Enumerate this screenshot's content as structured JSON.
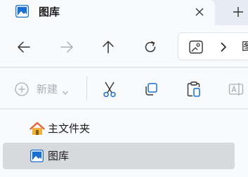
{
  "tab": {
    "title": "图库",
    "icon": "gallery-icon",
    "close_icon": "close-icon",
    "new_tab_icon": "plus-icon"
  },
  "nav": {
    "back_icon": "arrow-left-icon",
    "forward_icon": "arrow-right-icon",
    "up_icon": "arrow-up-icon",
    "refresh_icon": "refresh-icon",
    "address": {
      "icon": "gallery-outline-icon",
      "separator_icon": "chevron-right-icon",
      "path_segment": "图"
    }
  },
  "command_bar": {
    "new_label": "新建",
    "new_icon": "plus-circle-icon",
    "caret_icon": "chevron-down-icon",
    "cut_icon": "scissors-icon",
    "copy_icon": "copy-icon",
    "paste_icon": "clipboard-icon",
    "rename_icon": "rename-icon"
  },
  "nav_pane": {
    "items": [
      {
        "label": "主文件夹",
        "icon": "home-icon",
        "selected": false
      },
      {
        "label": "图库",
        "icon": "gallery-icon",
        "selected": true
      }
    ]
  },
  "colors": {
    "accent": "#1a6fd1",
    "disabled": "#a9afb8",
    "selection": "#d8d9dc",
    "home_roof": "#e8643c"
  }
}
